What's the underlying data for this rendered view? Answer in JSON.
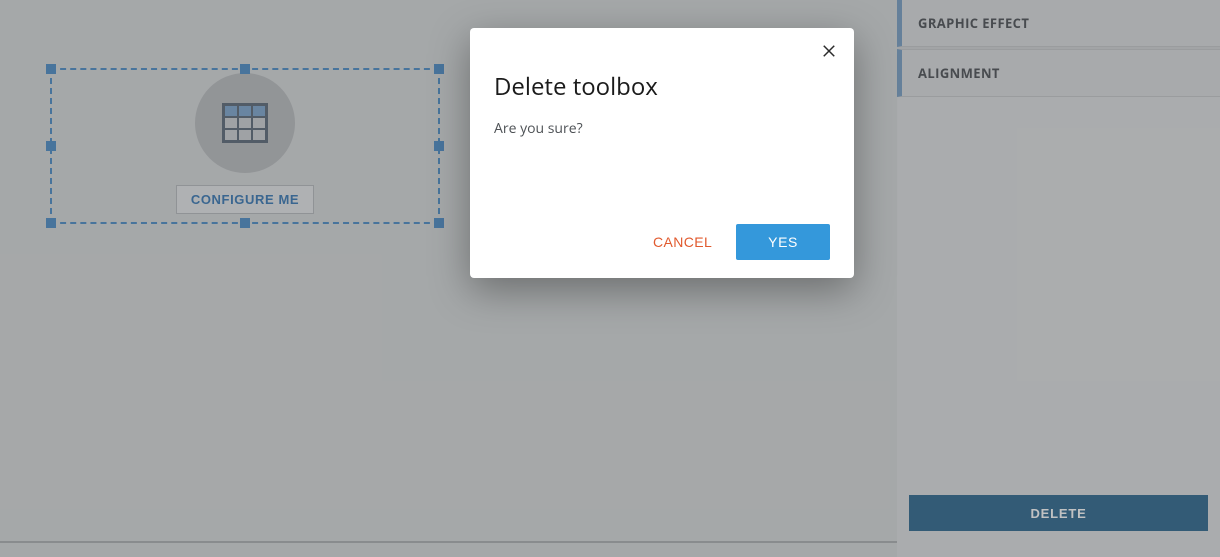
{
  "canvas": {
    "widget": {
      "configure_label": "CONFIGURE ME"
    }
  },
  "sidebar": {
    "sections": [
      {
        "label": "GRAPHIC EFFECT"
      },
      {
        "label": "ALIGNMENT"
      }
    ],
    "delete_button": "DELETE"
  },
  "dialog": {
    "title": "Delete toolbox",
    "message": "Are you sure?",
    "cancel_label": "CANCEL",
    "confirm_label": "YES"
  }
}
